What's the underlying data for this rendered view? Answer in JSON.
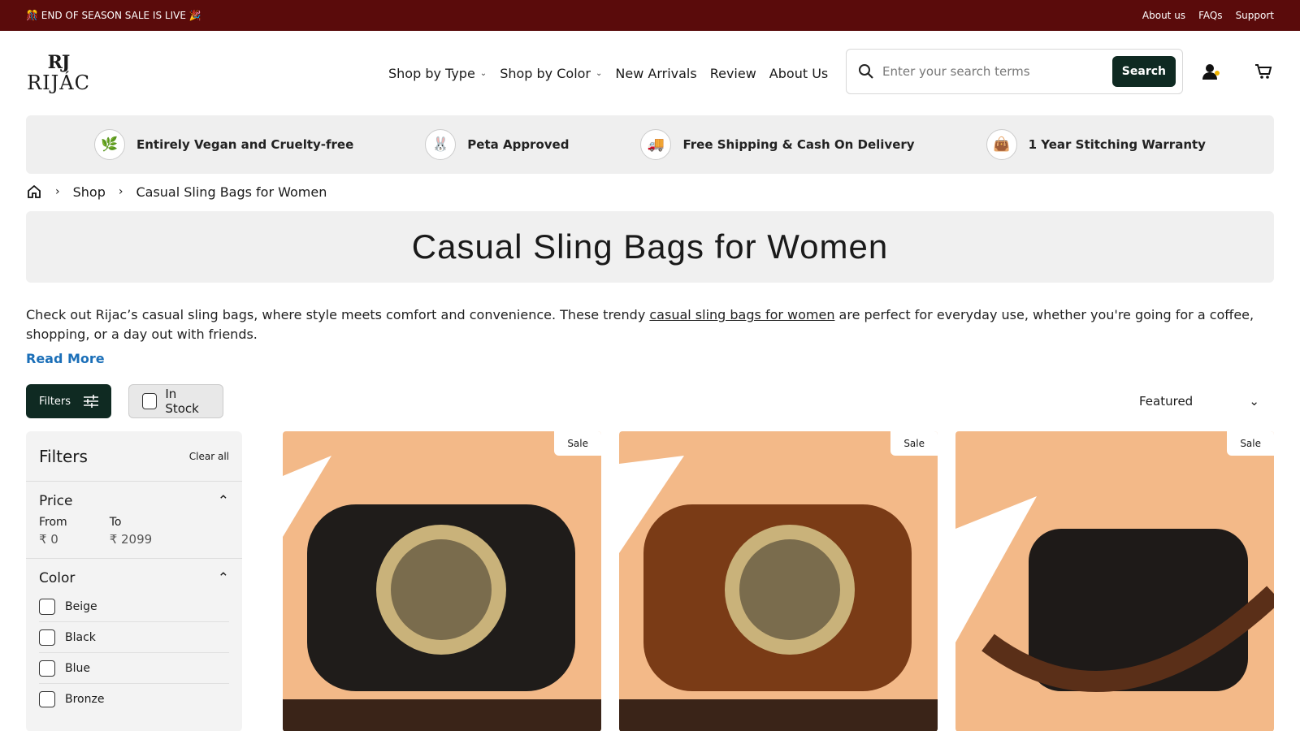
{
  "announcement": {
    "text": "🎊 END OF SEASON SALE IS LIVE 🎉",
    "links": [
      "About us",
      "FAQs",
      "Support"
    ]
  },
  "brand": {
    "monogram": "RJ",
    "wordmark": "RIJÁC"
  },
  "nav": [
    "Shop by Type",
    "Shop by Color",
    "New Arrivals",
    "Review",
    "About Us"
  ],
  "search": {
    "placeholder": "Enter your search terms",
    "button": "Search"
  },
  "usps": [
    {
      "label": "Entirely Vegan and Cruelty-free",
      "icon": "vegan-icon"
    },
    {
      "label": "Peta Approved",
      "icon": "bunny-icon"
    },
    {
      "label": "Free Shipping & Cash On Delivery",
      "icon": "truck-icon"
    },
    {
      "label": "1 Year Stitching Warranty",
      "icon": "bag-icon"
    }
  ],
  "breadcrumb": [
    "Shop",
    "Casual Sling Bags for Women"
  ],
  "page_title": "Casual Sling Bags for Women",
  "description": {
    "before": "Check out Rijac’s casual sling bags, where style meets comfort and convenience. These trendy ",
    "link": "casual sling bags for women",
    "after": " are perfect for everyday use, whether you're going for a coffee, shopping, or a day out with friends.",
    "read_more": "Read More"
  },
  "toolbar": {
    "filters": "Filters",
    "in_stock": "In Stock",
    "sort": "Featured"
  },
  "sidebar": {
    "title": "Filters",
    "clear": "Clear all",
    "price": {
      "label": "Price",
      "from_label": "From",
      "to_label": "To",
      "from": "₹ 0",
      "to": "₹ 2099"
    },
    "color": {
      "label": "Color",
      "options": [
        "Beige",
        "Black",
        "Blue",
        "Bronze"
      ]
    }
  },
  "products": [
    {
      "badge": "Sale",
      "color": "#1f1c1a"
    },
    {
      "badge": "Sale",
      "color": "#7a3b16"
    },
    {
      "badge": "Sale",
      "color": "#1e1a18"
    }
  ]
}
